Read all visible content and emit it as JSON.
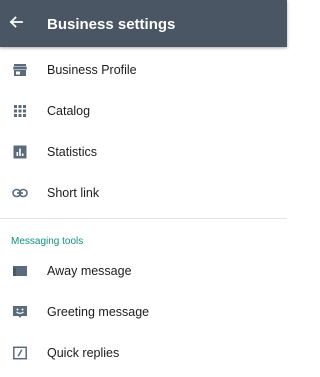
{
  "app_bar": {
    "title": "Business settings",
    "back_icon": "arrow-back-icon",
    "background": "#4a5663"
  },
  "main_items": [
    {
      "label": "Business Profile",
      "icon": "store-icon"
    },
    {
      "label": "Catalog",
      "icon": "grid-dots-icon"
    },
    {
      "label": "Statistics",
      "icon": "bar-chart-icon"
    },
    {
      "label": "Short link",
      "icon": "link-icon"
    }
  ],
  "messaging_tools": {
    "header": "Messaging tools",
    "header_color": "#12907d",
    "items": [
      {
        "label": "Away message",
        "icon": "away-message-icon"
      },
      {
        "label": "Greeting message",
        "icon": "greeting-message-icon"
      },
      {
        "label": "Quick replies",
        "icon": "quick-replies-icon"
      }
    ]
  },
  "icon_color": "#5b6b7c"
}
